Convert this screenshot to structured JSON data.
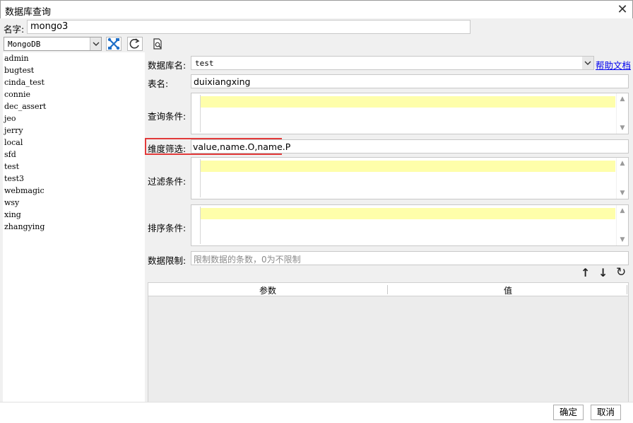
{
  "window": {
    "title": "数据库查询",
    "close_glyph": "✕"
  },
  "name_row": {
    "label": "名字:",
    "value": "mongo3"
  },
  "db_type": {
    "selected": "MongoDB"
  },
  "toolbar_icons": [
    "connection-settings-icon",
    "refresh-icon",
    "preview-icon"
  ],
  "databases": [
    "admin",
    "bugtest",
    "cinda_test",
    "connie",
    "dec_assert",
    "jeo",
    "jerry",
    "local",
    "sfd",
    "test",
    "test3",
    "webmagic",
    "wsy",
    "xing",
    "zhangying"
  ],
  "form": {
    "db_name_label": "数据库名:",
    "db_name_value": "test",
    "help_link": "帮助文档",
    "table_label": "表名:",
    "table_value": "duixiangxing",
    "query_label": "查询条件:",
    "dimension_label": "维度筛选:",
    "dimension_value": "value,name.O,name.P",
    "filter_label": "过滤条件:",
    "sort_label": "排序条件:",
    "limit_label": "数据限制:",
    "limit_placeholder": "限制数据的条数，0为不限制"
  },
  "param_table": {
    "col_param": "参数",
    "col_value": "值"
  },
  "param_actions": {
    "up": "↑",
    "down": "↓",
    "refresh": "↻"
  },
  "footer": {
    "ok": "确定",
    "cancel": "取消"
  },
  "colors": {
    "highlight_line": "#fefeaa",
    "callout": "#e23a3a",
    "link": "#0000ee",
    "icon_blue": "#1e6fc8"
  }
}
